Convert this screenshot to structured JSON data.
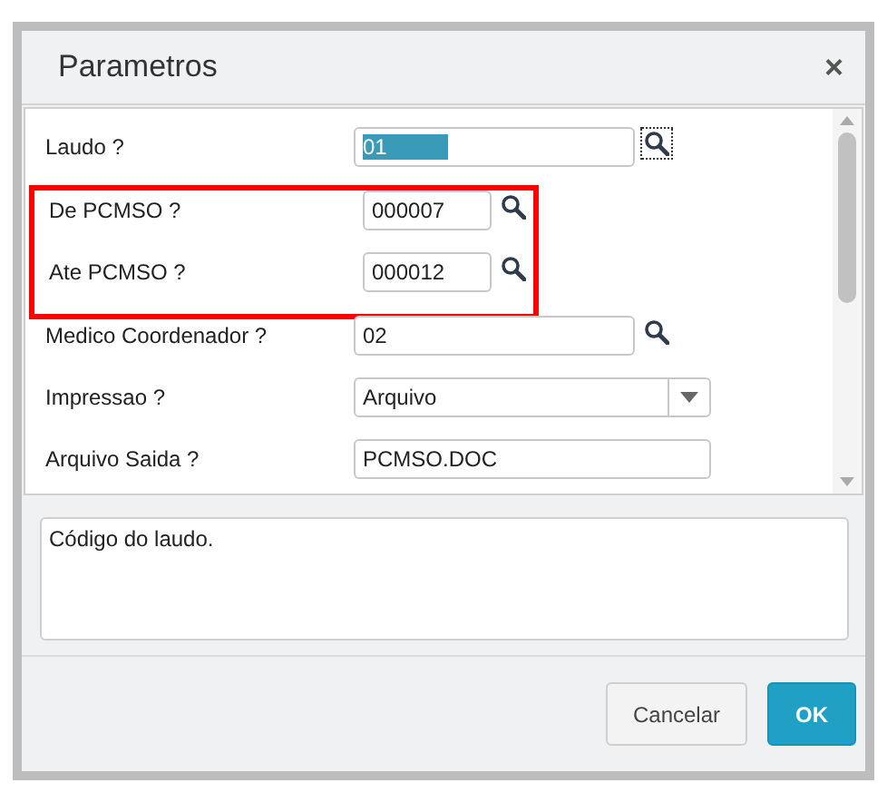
{
  "dialog": {
    "title": "Parametros",
    "close": "×"
  },
  "params": [
    {
      "label": "Laudo ?",
      "kind": "lookup",
      "value": "01",
      "focused": true,
      "highlighted": false
    },
    {
      "label": "De PCMSO ?",
      "kind": "lookup",
      "value": "000007",
      "focused": false,
      "highlighted": true
    },
    {
      "label": "Ate PCMSO ?",
      "kind": "lookup",
      "value": "000012",
      "focused": false,
      "highlighted": true
    },
    {
      "label": "Medico Coordenador ?",
      "kind": "lookup",
      "value": "02",
      "focused": false,
      "highlighted": false
    },
    {
      "label": "Impressao ?",
      "kind": "select",
      "value": "Arquivo",
      "focused": false,
      "highlighted": false
    },
    {
      "label": "Arquivo Saida ?",
      "kind": "text",
      "value": "PCMSO.DOC",
      "focused": false,
      "highlighted": false
    }
  ],
  "help": "Código do laudo.",
  "buttons": [
    {
      "label": "Cancelar",
      "kind": "secondary"
    },
    {
      "label": "OK",
      "kind": "primary"
    }
  ]
}
